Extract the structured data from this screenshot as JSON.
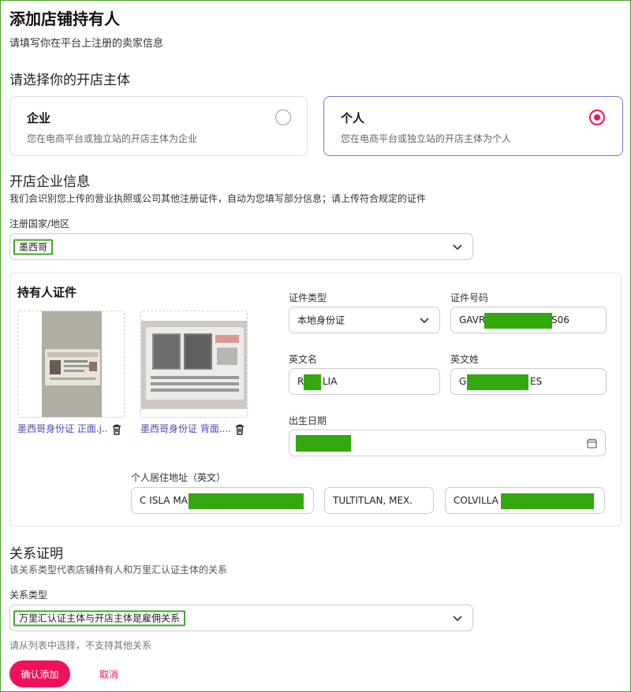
{
  "header": {
    "title": "添加店铺持有人",
    "subtitle": "请填写你在平台上注册的卖家信息"
  },
  "entity": {
    "heading": "请选择你的开店主体",
    "options": [
      {
        "title": "企业",
        "desc": "您在电商平台或独立站的开店主体为企业",
        "selected": false
      },
      {
        "title": "个人",
        "desc": "您在电商平台或独立站的开店主体为个人",
        "selected": true
      }
    ]
  },
  "company": {
    "heading": "开店企业信息",
    "desc": "我们会识别您上传的营业执照或公司其他注册证件，自动为您填写部分信息；请上传符合规定的证件",
    "country_label": "注册国家/地区",
    "country_value": "墨西哥"
  },
  "holder": {
    "heading": "持有人证件",
    "docs": [
      {
        "caption": "墨西哥身份证 正面.j...",
        "icon": "trash-icon"
      },
      {
        "caption": "墨西哥身份证 背面....",
        "icon": "trash-icon"
      }
    ],
    "id_type_label": "证件类型",
    "id_type_value": "本地身份证",
    "id_number_label": "证件号码",
    "id_number_prefix": "GAVR",
    "id_number_suffix": "S06",
    "first_name_label": "英文名",
    "first_name_prefix": "R",
    "first_name_suffix": "LIA",
    "last_name_label": "英文姓",
    "last_name_prefix": "G",
    "last_name_suffix": "ES",
    "birth_label": "出生日期",
    "address_label": "个人居住地址（英文）",
    "address_1_prefix": "C ISLA MA",
    "address_2": "TULTITLAN, MEX.",
    "address_3_prefix": "COLVILLA"
  },
  "relation": {
    "heading": "关系证明",
    "desc": "该关系类型代表店铺持有人和万里汇认证主体的关系",
    "type_label": "关系类型",
    "type_value": "万里汇认证主体与开店主体是雇佣关系",
    "hint": "请从列表中选择，不支持其他关系"
  },
  "actions": {
    "confirm": "确认添加",
    "cancel": "取消"
  },
  "colors": {
    "accent": "#f0115a",
    "selected_border": "#7a78c8",
    "redaction": "#33a80f",
    "link": "#4a49b5"
  }
}
